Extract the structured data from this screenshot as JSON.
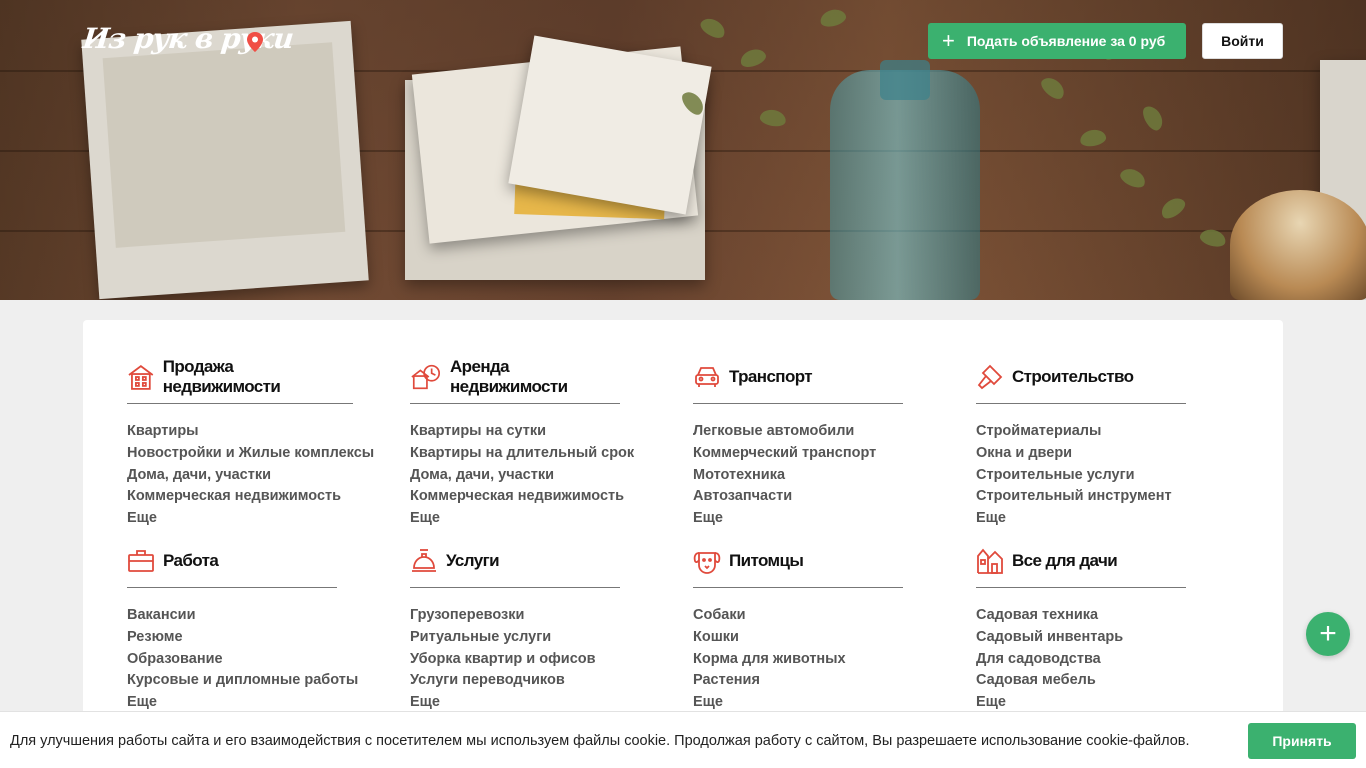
{
  "header": {
    "logo_text": "Из рук в руки",
    "post_ad_label": "Подать объявление за 0 руб",
    "login_label": "Войти"
  },
  "categories": [
    {
      "title": "Продажа недвижимости",
      "icon": "house-icon",
      "links": [
        "Квартиры",
        "Новостройки и Жилые комплексы",
        "Дома, дачи, участки",
        "Коммерческая недвижимость",
        "Еще"
      ]
    },
    {
      "title": "Аренда недвижимости",
      "icon": "house-clock-icon",
      "links": [
        "Квартиры на сутки",
        "Квартиры на длительный срок",
        "Дома, дачи, участки",
        "Коммерческая недвижимость",
        "Еще"
      ]
    },
    {
      "title": "Транспорт",
      "icon": "car-icon",
      "links": [
        "Легковые автомобили",
        "Коммерческий транспорт",
        "Мототехника",
        "Автозапчасти",
        "Еще"
      ]
    },
    {
      "title": "Строительство",
      "icon": "paint-brush-icon",
      "links": [
        "Стройматериалы",
        "Окна и двери",
        "Строительные услуги",
        "Строительный инструмент",
        "Еще"
      ]
    },
    {
      "title": "Работа",
      "icon": "briefcase-icon",
      "links": [
        "Вакансии",
        "Резюме",
        "Образование",
        "Курсовые и дипломные работы",
        "Еще"
      ]
    },
    {
      "title": "Услуги",
      "icon": "service-bell-icon",
      "links": [
        "Грузоперевозки",
        "Ритуальные услуги",
        "Уборка квартир и офисов",
        "Услуги переводчиков",
        "Еще"
      ]
    },
    {
      "title": "Питомцы",
      "icon": "dog-icon",
      "links": [
        "Собаки",
        "Кошки",
        "Корма для животных",
        "Растения",
        "Еще"
      ]
    },
    {
      "title": "Все для дачи",
      "icon": "country-house-icon",
      "links": [
        "Садовая техника",
        "Садовый инвентарь",
        "Для садоводства",
        "Садовая мебель",
        "Еще"
      ]
    }
  ],
  "cookie": {
    "text": "Для улучшения работы сайта и его взаимодействия с посетителем мы используем файлы cookie. Продолжая работу с сайтом, Вы разрешаете использование cookie-файлов.",
    "accept_label": "Принять"
  },
  "colors": {
    "accent_green": "#3bb16f",
    "icon_red": "#e04a3c"
  }
}
